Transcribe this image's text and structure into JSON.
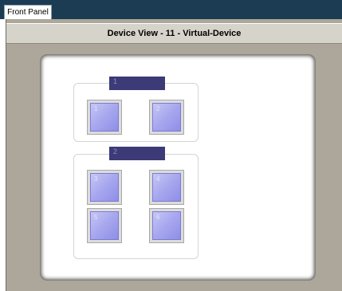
{
  "tabs": [
    {
      "label": "Front Panel"
    }
  ],
  "device_view": {
    "title": "Device View - 11 - Virtual-Device",
    "groups": [
      {
        "label": "1",
        "slots": [
          "1",
          "2"
        ]
      },
      {
        "label": "2",
        "slots": [
          "3",
          "4",
          "5",
          "6"
        ]
      }
    ]
  },
  "colors": {
    "top_bar": "#1b3c52",
    "panel_background": "#aca79a",
    "group_label": "#3c3a77",
    "slot_face": "#a9a9ef"
  }
}
